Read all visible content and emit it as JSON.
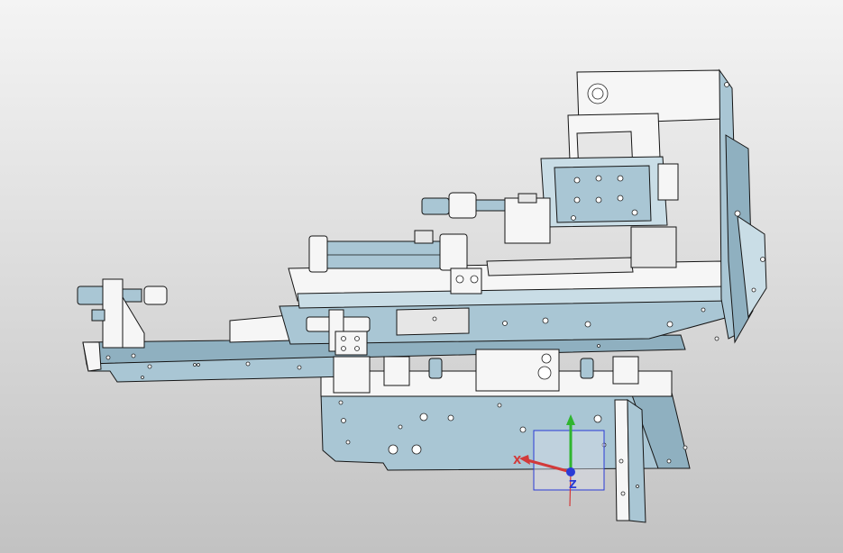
{
  "viewport": {
    "background_top": "#f4f4f4",
    "background_bottom": "#c2c2c2"
  },
  "model": {
    "metal_color": "#a9c6d4",
    "plastic_color": "#f6f6f6",
    "edge_color": "#151515"
  },
  "triad": {
    "x_label": "X",
    "z_label": "Z",
    "x_color": "#d23a3a",
    "y_color": "#2fb52f",
    "z_color": "#2a3bd6"
  }
}
